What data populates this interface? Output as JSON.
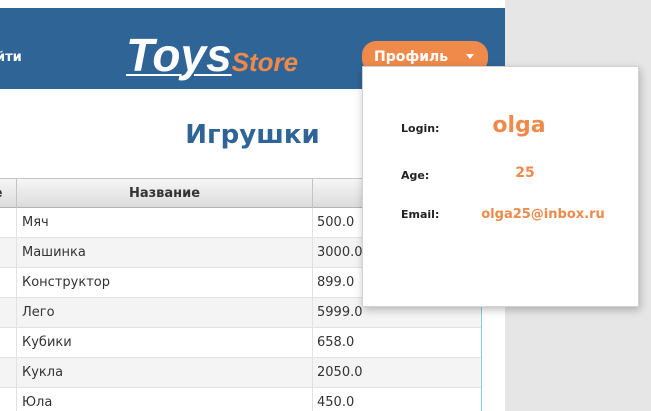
{
  "header": {
    "exit_label": "йти",
    "logo_main": "Toys",
    "logo_sub": "Store",
    "profile_label": "Профиль"
  },
  "page": {
    "title": "Игрушки"
  },
  "table": {
    "columns": [
      "е",
      "Название",
      ""
    ],
    "rows": [
      [
        "",
        "Мяч",
        "500.0"
      ],
      [
        "",
        "Машинка",
        "3000.0"
      ],
      [
        "",
        "Конструктор",
        "899.0"
      ],
      [
        "",
        "Лего",
        "5999.0"
      ],
      [
        "",
        "Кубики",
        "658.0"
      ],
      [
        "",
        "Кукла",
        "2050.0"
      ],
      [
        "",
        "Юла",
        "450.0"
      ]
    ]
  },
  "profile_popup": {
    "login_label": "Login:",
    "login_value": "olga",
    "age_label": "Age:",
    "age_value": "25",
    "email_label": "Email:",
    "email_value": "olga25@inbox.ru"
  },
  "colors": {
    "header_bg": "#2f6497",
    "accent": "#f08a4b",
    "title": "#2f6497"
  }
}
